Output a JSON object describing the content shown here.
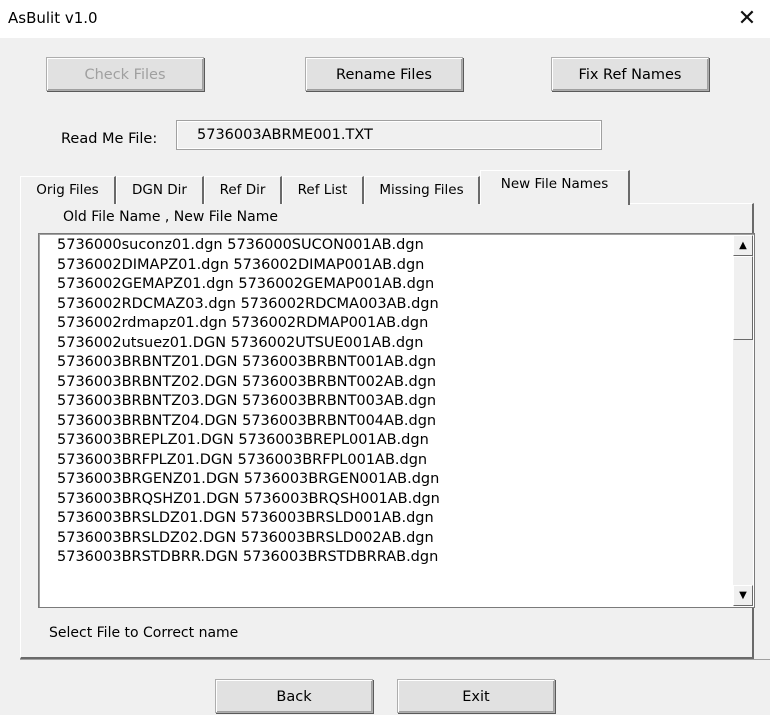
{
  "window": {
    "title": "AsBulit v1.0",
    "close_glyph": "✕"
  },
  "toolbar": {
    "check_files": "Check Files",
    "rename_files": "Rename Files",
    "fix_ref_names": "Fix Ref Names"
  },
  "readme": {
    "label": "Read Me File:",
    "value": "5736003ABRME001.TXT"
  },
  "tabs": [
    {
      "label": "Orig Files"
    },
    {
      "label": "DGN Dir"
    },
    {
      "label": "Ref Dir"
    },
    {
      "label": "Ref List"
    },
    {
      "label": "Missing Files"
    },
    {
      "label": "New File Names"
    }
  ],
  "active_tab": "New File Names",
  "list": {
    "header": "Old File Name , New File Name",
    "items": [
      "5736000suconz01.dgn 5736000SUCON001AB.dgn",
      "5736002DIMAPZ01.dgn 5736002DIMAP001AB.dgn",
      "5736002GEMAPZ01.dgn 5736002GEMAP001AB.dgn",
      "5736002RDCMAZ03.dgn 5736002RDCMA003AB.dgn",
      "5736002rdmapz01.dgn 5736002RDMAP001AB.dgn",
      "5736002utsuez01.DGN 5736002UTSUE001AB.dgn",
      "5736003BRBNTZ01.DGN 5736003BRBNT001AB.dgn",
      "5736003BRBNTZ02.DGN 5736003BRBNT002AB.dgn",
      "5736003BRBNTZ03.DGN 5736003BRBNT003AB.dgn",
      "5736003BRBNTZ04.DGN 5736003BRBNT004AB.dgn",
      "5736003BREPLZ01.DGN 5736003BREPL001AB.dgn",
      "5736003BRFPLZ01.DGN 5736003BRFPL001AB.dgn",
      "5736003BRGENZ01.DGN 5736003BRGEN001AB.dgn",
      "5736003BRQSHZ01.DGN 5736003BRQSH001AB.dgn",
      "5736003BRSLDZ01.DGN 5736003BRSLD001AB.dgn",
      "5736003BRSLDZ02.DGN 5736003BRSLD002AB.dgn",
      "5736003BRSTDBRR.DGN 5736003BRSTDBRRAB.dgn"
    ],
    "footer": "Select File to Correct name",
    "scroll_up_glyph": "▲",
    "scroll_down_glyph": "▼"
  },
  "bottom": {
    "back": "Back",
    "exit": "Exit"
  }
}
